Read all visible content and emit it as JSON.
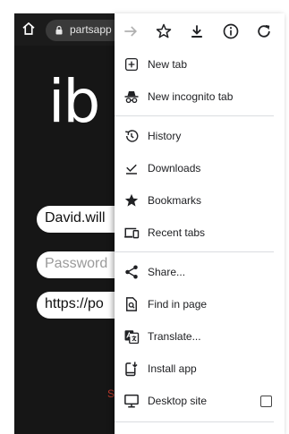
{
  "browser": {
    "url": "partsapp",
    "icons": {
      "home": "home-icon",
      "lock": "lock-icon",
      "forward": "forward-arrow-icon",
      "bookmark": "star-icon",
      "download": "download-icon",
      "info": "info-icon",
      "reload": "reload-icon"
    }
  },
  "page": {
    "logo": "ib",
    "username_value": "David.will",
    "password_placeholder": "Password",
    "url_value": "https://po",
    "red_char": "S"
  },
  "menu": {
    "items": [
      {
        "label": "New tab",
        "icon": "new-tab-icon"
      },
      {
        "label": "New incognito tab",
        "icon": "incognito-icon"
      },
      {
        "label": "History",
        "icon": "history-icon"
      },
      {
        "label": "Downloads",
        "icon": "downloads-icon"
      },
      {
        "label": "Bookmarks",
        "icon": "bookmark-star-icon"
      },
      {
        "label": "Recent tabs",
        "icon": "recent-tabs-icon"
      },
      {
        "label": "Share...",
        "icon": "share-icon"
      },
      {
        "label": "Find in page",
        "icon": "find-in-page-icon"
      },
      {
        "label": "Translate...",
        "icon": "translate-icon"
      },
      {
        "label": "Install app",
        "icon": "install-app-icon"
      },
      {
        "label": "Desktop site",
        "icon": "desktop-site-icon",
        "checked": false
      }
    ]
  },
  "colors": {
    "page_background": "#161616",
    "menu_background": "#ffffff",
    "menu_text": "#202124",
    "divider": "#dadce0"
  }
}
